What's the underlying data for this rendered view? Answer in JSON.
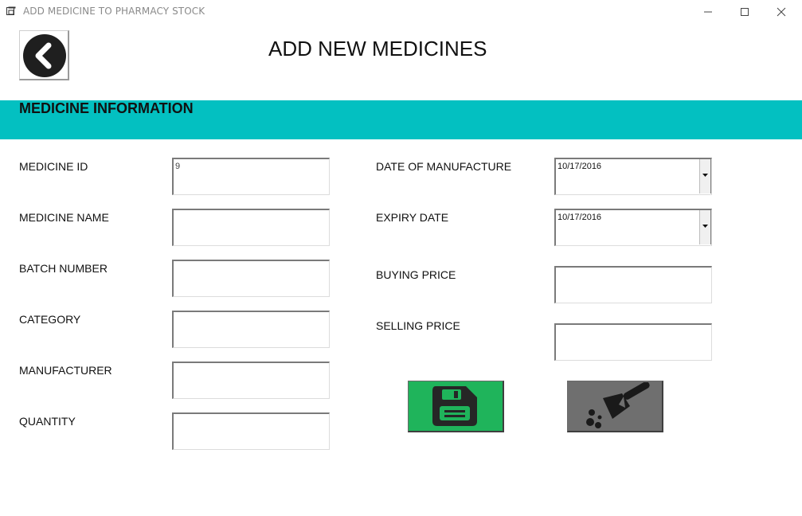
{
  "window": {
    "title": "ADD MEDICINE TO PHARMACY STOCK",
    "icons": [
      "app-icon",
      "minimize-icon",
      "maximize-icon",
      "close-icon"
    ]
  },
  "header": {
    "back_icon": "arrow-left-circle-icon",
    "page_title": "ADD NEW MEDICINES"
  },
  "section": {
    "title": "MEDICINE INFORMATION",
    "band_color": "#03c0c1"
  },
  "left_fields": [
    {
      "label": "MEDICINE ID",
      "value": "9"
    },
    {
      "label": "MEDICINE NAME",
      "value": ""
    },
    {
      "label": "BATCH NUMBER",
      "value": ""
    },
    {
      "label": "CATEGORY",
      "value": ""
    },
    {
      "label": "MANUFACTURER",
      "value": ""
    },
    {
      "label": "QUANTITY",
      "value": ""
    }
  ],
  "right_fields": {
    "manufacture_date": {
      "label": "DATE OF MANUFACTURE",
      "value": "10/17/2016"
    },
    "expiry_date": {
      "label": "EXPIRY DATE",
      "value": "10/17/2016"
    },
    "buying_price": {
      "label": "BUYING PRICE",
      "value": ""
    },
    "selling_price": {
      "label": "SELLING PRICE",
      "value": ""
    }
  },
  "actions": {
    "save": {
      "icon": "save-floppy-icon",
      "color": "#1fb45b"
    },
    "clear": {
      "icon": "broom-clear-icon",
      "color": "#6f6f6f"
    }
  }
}
